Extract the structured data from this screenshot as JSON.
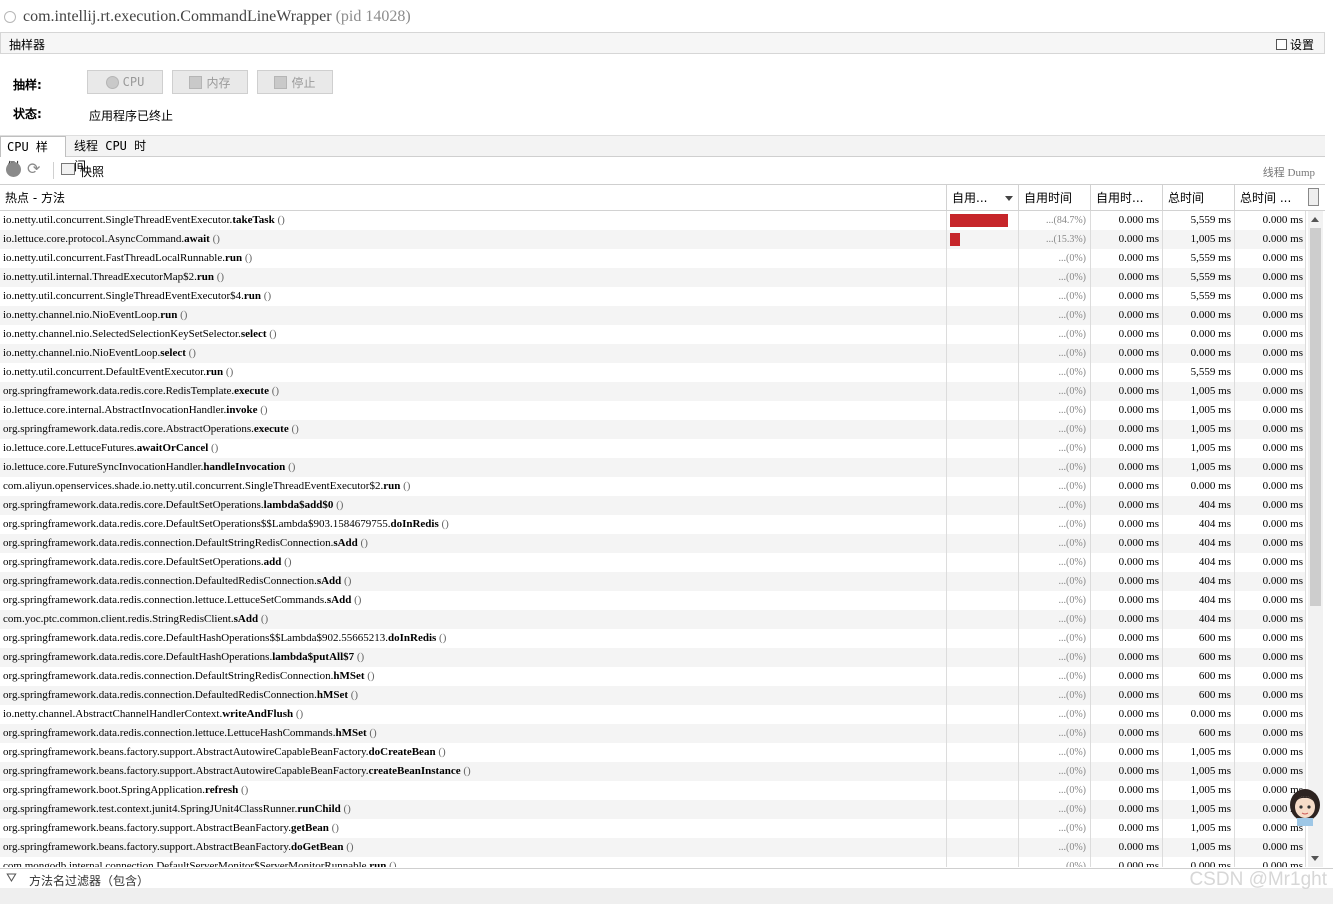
{
  "window": {
    "process_name": "com.intellij.rt.execution.CommandLineWrapper",
    "pid_label": "(pid 14028)"
  },
  "sampler": {
    "title": "抽样器",
    "settings_label": "设置",
    "sample_label": "抽样:",
    "buttons": {
      "cpu": "CPU",
      "memory": "内存",
      "stop": "停止"
    },
    "status_label": "状态:",
    "status_value": "应用程序已终止"
  },
  "tabs": [
    "CPU 样例",
    "线程 CPU 时间"
  ],
  "toolbar": {
    "snapshot": "快照",
    "thread_dump": "线程 Dump"
  },
  "table": {
    "columns": [
      "热点 - 方法",
      "自用...",
      "自用时间",
      "自用时...",
      "总时间",
      "总时间 ..."
    ],
    "rows": [
      {
        "cls": "io.netty.util.concurrent.SingleThreadEventExecutor.",
        "m": "takeTask",
        "pct": "...(84.7%)",
        "bar": 84.7,
        "self": "0.000 ms",
        "total": "5,559 ms",
        "total2": "0.000 ms"
      },
      {
        "cls": "io.lettuce.core.protocol.AsyncCommand.",
        "m": "await",
        "pct": "...(15.3%)",
        "bar": 15.3,
        "self": "0.000 ms",
        "total": "1,005 ms",
        "total2": "0.000 ms"
      },
      {
        "cls": "io.netty.util.concurrent.FastThreadLocalRunnable.",
        "m": "run",
        "pct": "...(0%)",
        "bar": 0,
        "self": "0.000 ms",
        "total": "5,559 ms",
        "total2": "0.000 ms"
      },
      {
        "cls": "io.netty.util.internal.ThreadExecutorMap$2.",
        "m": "run",
        "pct": "...(0%)",
        "bar": 0,
        "self": "0.000 ms",
        "total": "5,559 ms",
        "total2": "0.000 ms"
      },
      {
        "cls": "io.netty.util.concurrent.SingleThreadEventExecutor$4.",
        "m": "run",
        "pct": "...(0%)",
        "bar": 0,
        "self": "0.000 ms",
        "total": "5,559 ms",
        "total2": "0.000 ms"
      },
      {
        "cls": "io.netty.channel.nio.NioEventLoop.",
        "m": "run",
        "pct": "...(0%)",
        "bar": 0,
        "self": "0.000 ms",
        "total": "0.000 ms",
        "total2": "0.000 ms"
      },
      {
        "cls": "io.netty.channel.nio.SelectedSelectionKeySetSelector.",
        "m": "select",
        "pct": "...(0%)",
        "bar": 0,
        "self": "0.000 ms",
        "total": "0.000 ms",
        "total2": "0.000 ms"
      },
      {
        "cls": "io.netty.channel.nio.NioEventLoop.",
        "m": "select",
        "pct": "...(0%)",
        "bar": 0,
        "self": "0.000 ms",
        "total": "0.000 ms",
        "total2": "0.000 ms"
      },
      {
        "cls": "io.netty.util.concurrent.DefaultEventExecutor.",
        "m": "run",
        "pct": "...(0%)",
        "bar": 0,
        "self": "0.000 ms",
        "total": "5,559 ms",
        "total2": "0.000 ms"
      },
      {
        "cls": "org.springframework.data.redis.core.RedisTemplate.",
        "m": "execute",
        "pct": "...(0%)",
        "bar": 0,
        "self": "0.000 ms",
        "total": "1,005 ms",
        "total2": "0.000 ms"
      },
      {
        "cls": "io.lettuce.core.internal.AbstractInvocationHandler.",
        "m": "invoke",
        "pct": "...(0%)",
        "bar": 0,
        "self": "0.000 ms",
        "total": "1,005 ms",
        "total2": "0.000 ms"
      },
      {
        "cls": "org.springframework.data.redis.core.AbstractOperations.",
        "m": "execute",
        "pct": "...(0%)",
        "bar": 0,
        "self": "0.000 ms",
        "total": "1,005 ms",
        "total2": "0.000 ms"
      },
      {
        "cls": "io.lettuce.core.LettuceFutures.",
        "m": "awaitOrCancel",
        "pct": "...(0%)",
        "bar": 0,
        "self": "0.000 ms",
        "total": "1,005 ms",
        "total2": "0.000 ms"
      },
      {
        "cls": "io.lettuce.core.FutureSyncInvocationHandler.",
        "m": "handleInvocation",
        "pct": "...(0%)",
        "bar": 0,
        "self": "0.000 ms",
        "total": "1,005 ms",
        "total2": "0.000 ms"
      },
      {
        "cls": "com.aliyun.openservices.shade.io.netty.util.concurrent.SingleThreadEventExecutor$2.",
        "m": "run",
        "pct": "...(0%)",
        "bar": 0,
        "self": "0.000 ms",
        "total": "0.000 ms",
        "total2": "0.000 ms"
      },
      {
        "cls": "org.springframework.data.redis.core.DefaultSetOperations.",
        "m": "lambda$add$0",
        "pct": "...(0%)",
        "bar": 0,
        "self": "0.000 ms",
        "total": "404 ms",
        "total2": "0.000 ms"
      },
      {
        "cls": "org.springframework.data.redis.core.DefaultSetOperations$$Lambda$903.1584679755.",
        "m": "doInRedis",
        "pct": "...(0%)",
        "bar": 0,
        "self": "0.000 ms",
        "total": "404 ms",
        "total2": "0.000 ms"
      },
      {
        "cls": "org.springframework.data.redis.connection.DefaultStringRedisConnection.",
        "m": "sAdd",
        "pct": "...(0%)",
        "bar": 0,
        "self": "0.000 ms",
        "total": "404 ms",
        "total2": "0.000 ms"
      },
      {
        "cls": "org.springframework.data.redis.core.DefaultSetOperations.",
        "m": "add",
        "pct": "...(0%)",
        "bar": 0,
        "self": "0.000 ms",
        "total": "404 ms",
        "total2": "0.000 ms"
      },
      {
        "cls": "org.springframework.data.redis.connection.DefaultedRedisConnection.",
        "m": "sAdd",
        "pct": "...(0%)",
        "bar": 0,
        "self": "0.000 ms",
        "total": "404 ms",
        "total2": "0.000 ms"
      },
      {
        "cls": "org.springframework.data.redis.connection.lettuce.LettuceSetCommands.",
        "m": "sAdd",
        "pct": "...(0%)",
        "bar": 0,
        "self": "0.000 ms",
        "total": "404 ms",
        "total2": "0.000 ms"
      },
      {
        "cls": "com.yoc.ptc.common.client.redis.StringRedisClient.",
        "m": "sAdd",
        "pct": "...(0%)",
        "bar": 0,
        "self": "0.000 ms",
        "total": "404 ms",
        "total2": "0.000 ms"
      },
      {
        "cls": "org.springframework.data.redis.core.DefaultHashOperations$$Lambda$902.55665213.",
        "m": "doInRedis",
        "pct": "...(0%)",
        "bar": 0,
        "self": "0.000 ms",
        "total": "600 ms",
        "total2": "0.000 ms"
      },
      {
        "cls": "org.springframework.data.redis.core.DefaultHashOperations.",
        "m": "lambda$putAll$7",
        "pct": "...(0%)",
        "bar": 0,
        "self": "0.000 ms",
        "total": "600 ms",
        "total2": "0.000 ms"
      },
      {
        "cls": "org.springframework.data.redis.connection.DefaultStringRedisConnection.",
        "m": "hMSet",
        "pct": "...(0%)",
        "bar": 0,
        "self": "0.000 ms",
        "total": "600 ms",
        "total2": "0.000 ms"
      },
      {
        "cls": "org.springframework.data.redis.connection.DefaultedRedisConnection.",
        "m": "hMSet",
        "pct": "...(0%)",
        "bar": 0,
        "self": "0.000 ms",
        "total": "600 ms",
        "total2": "0.000 ms"
      },
      {
        "cls": "io.netty.channel.AbstractChannelHandlerContext.",
        "m": "writeAndFlush",
        "pct": "...(0%)",
        "bar": 0,
        "self": "0.000 ms",
        "total": "0.000 ms",
        "total2": "0.000 ms"
      },
      {
        "cls": "org.springframework.data.redis.connection.lettuce.LettuceHashCommands.",
        "m": "hMSet",
        "pct": "...(0%)",
        "bar": 0,
        "self": "0.000 ms",
        "total": "600 ms",
        "total2": "0.000 ms"
      },
      {
        "cls": "org.springframework.beans.factory.support.AbstractAutowireCapableBeanFactory.",
        "m": "doCreateBean",
        "pct": "...(0%)",
        "bar": 0,
        "self": "0.000 ms",
        "total": "1,005 ms",
        "total2": "0.000 ms"
      },
      {
        "cls": "org.springframework.beans.factory.support.AbstractAutowireCapableBeanFactory.",
        "m": "createBeanInstance",
        "pct": "...(0%)",
        "bar": 0,
        "self": "0.000 ms",
        "total": "1,005 ms",
        "total2": "0.000 ms"
      },
      {
        "cls": "org.springframework.boot.SpringApplication.",
        "m": "refresh",
        "pct": "...(0%)",
        "bar": 0,
        "self": "0.000 ms",
        "total": "1,005 ms",
        "total2": "0.000 ms"
      },
      {
        "cls": "org.springframework.test.context.junit4.SpringJUnit4ClassRunner.",
        "m": "runChild",
        "pct": "...(0%)",
        "bar": 0,
        "self": "0.000 ms",
        "total": "1,005 ms",
        "total2": "0.000 ms"
      },
      {
        "cls": "org.springframework.beans.factory.support.AbstractBeanFactory.",
        "m": "getBean",
        "pct": "...(0%)",
        "bar": 0,
        "self": "0.000 ms",
        "total": "1,005 ms",
        "total2": "0.000 ms"
      },
      {
        "cls": "org.springframework.beans.factory.support.AbstractBeanFactory.",
        "m": "doGetBean",
        "pct": "...(0%)",
        "bar": 0,
        "self": "0.000 ms",
        "total": "1,005 ms",
        "total2": "0.000 ms"
      },
      {
        "cls": "com.mongodb.internal.connection.DefaultServerMonitor$ServerMonitorRunnable.",
        "m": "run",
        "pct": "...(0%)",
        "bar": 0,
        "self": "0.000 ms",
        "total": "0.000 ms",
        "total2": "0.000 ms"
      }
    ],
    "paren": "()",
    "bar_color": "#c6262a"
  },
  "filter": {
    "label": "方法名过滤器（包含）"
  },
  "watermark": "CSDN @Mr1ght"
}
